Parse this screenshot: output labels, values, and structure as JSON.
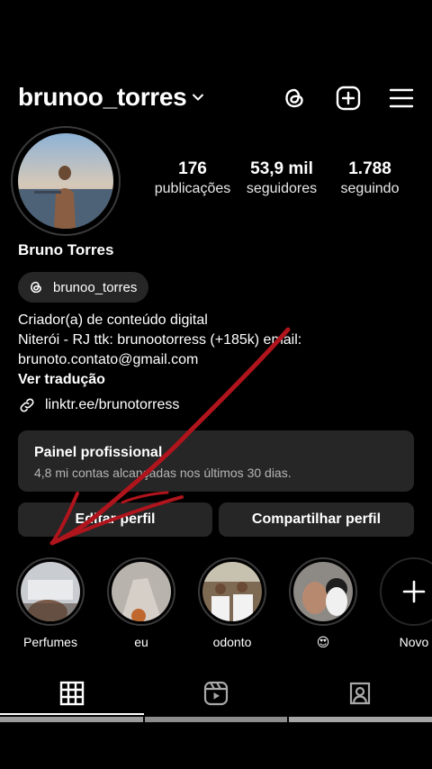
{
  "header": {
    "username": "brunoo_torres",
    "icons": [
      "threads-icon",
      "new-post-icon",
      "menu-icon"
    ]
  },
  "stats": [
    {
      "value": "176",
      "label": "publicações"
    },
    {
      "value": "53,9 mil",
      "label": "seguidores"
    },
    {
      "value": "1.788",
      "label": "seguindo"
    }
  ],
  "profile": {
    "name": "Bruno Torres",
    "threads_handle": "brunoo_torres",
    "bio_line1": "Criador(a) de conteúdo digital",
    "bio_line2": "Niterói - RJ ttk: brunootorress (+185k) email:",
    "bio_line3": "brunoto.contato@gmail.com",
    "translate": "Ver tradução",
    "link": "linktr.ee/brunotorress"
  },
  "panel": {
    "title": "Painel profissional",
    "subtitle": "4,8 mi contas alcançadas nos últimos 30 dias."
  },
  "buttons": {
    "edit": "Editar perfil",
    "share": "Compartilhar perfil"
  },
  "highlights": [
    {
      "label": "Perfumes"
    },
    {
      "label": "eu"
    },
    {
      "label": "odonto"
    },
    {
      "label": "😍"
    },
    {
      "label": "Novo"
    }
  ],
  "colors": {
    "background": "#000000",
    "surface": "#262626",
    "annotation_red": "#b0141c"
  }
}
